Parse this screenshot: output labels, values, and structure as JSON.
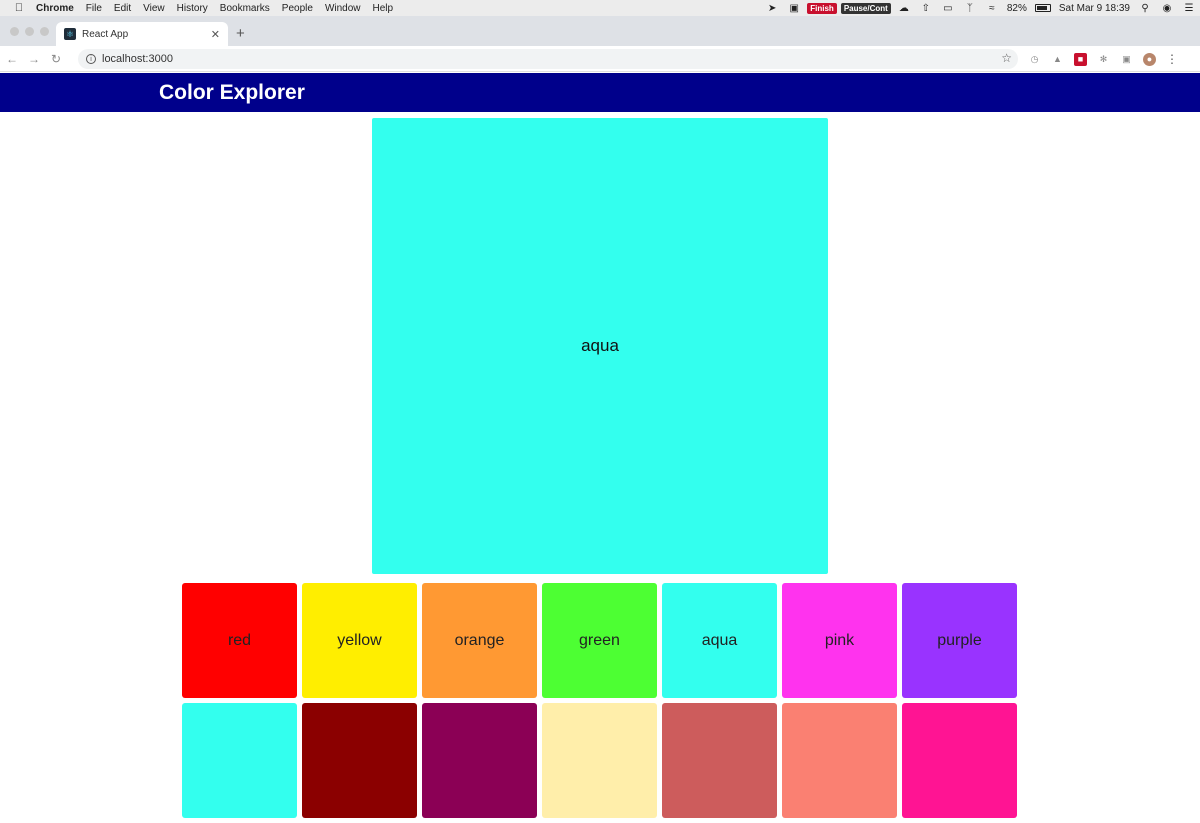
{
  "menubar": {
    "app_name": "Chrome",
    "menus": [
      "File",
      "Edit",
      "View",
      "History",
      "Bookmarks",
      "People",
      "Window",
      "Help"
    ],
    "finish_badge": "Finish",
    "pause_badge": "Pause/Cont",
    "battery": "82%",
    "clock": "Sat Mar 9  18:39"
  },
  "browser": {
    "tab_title": "React App",
    "url": "localhost:3000"
  },
  "app": {
    "title": "Color Explorer",
    "selected": {
      "name": "aqua",
      "color": "#33ffee"
    },
    "swatches": [
      {
        "name": "red",
        "color": "#ff0000"
      },
      {
        "name": "yellow",
        "color": "#ffee00"
      },
      {
        "name": "orange",
        "color": "#ff9933"
      },
      {
        "name": "green",
        "color": "#4dff33"
      },
      {
        "name": "aqua",
        "color": "#33ffee"
      },
      {
        "name": "pink",
        "color": "#ff33ee"
      },
      {
        "name": "purple",
        "color": "#9933ff"
      }
    ],
    "swatches_row2": [
      {
        "color": "#33ffee"
      },
      {
        "color": "#8b0000"
      },
      {
        "color": "#8b0055"
      },
      {
        "color": "#ffeeaa"
      },
      {
        "color": "#cd5c5c"
      },
      {
        "color": "#fa8072"
      },
      {
        "color": "#ff1493"
      }
    ]
  }
}
